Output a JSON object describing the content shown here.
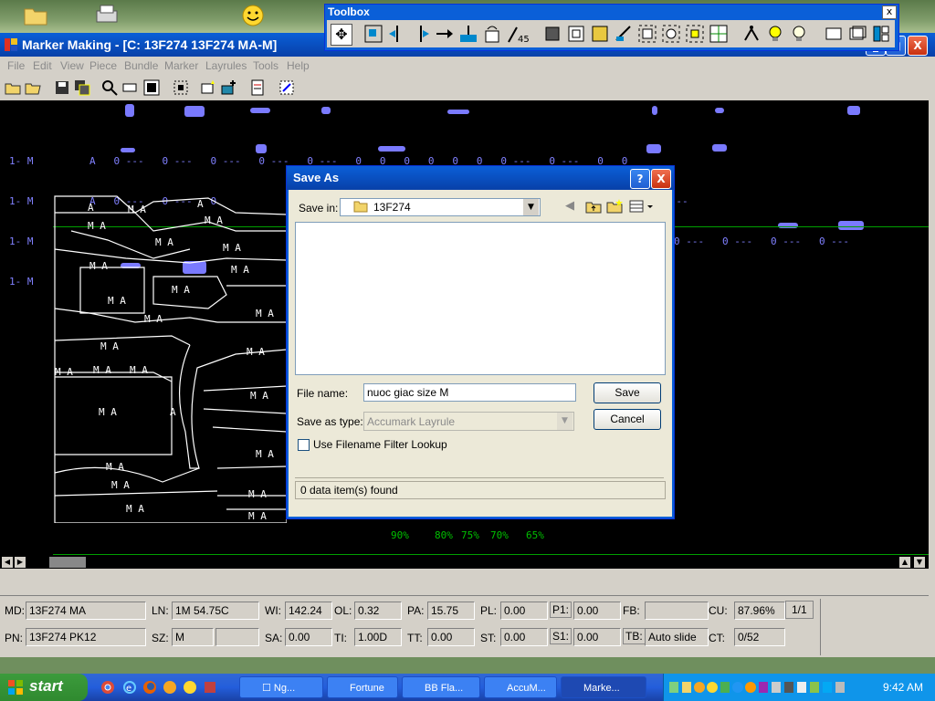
{
  "window": {
    "title": "Marker Making - [C:  13F274  13F274 MA-M]",
    "minimize_label": "_",
    "maximize_label": "□",
    "close_label": "X"
  },
  "toolbox": {
    "title": "Toolbox",
    "close_label": "x"
  },
  "menu": [
    "File",
    "Edit",
    "View",
    "Piece",
    "Bundle",
    "Marker",
    "Layrules",
    "Tools",
    "Help"
  ],
  "canvas": {
    "rows": [
      {
        "label": "1- M",
        "text": "A   0 ---   0 ---   0 ---   0 ---   0 ---   0   0   0   0   0   0   0 ---   0 ---   0   0"
      },
      {
        "label": "1- M",
        "text": "A   0 ---   0 ---   0                                                         0 ---   0 ---   0 ---"
      },
      {
        "label": "1- M",
        "text": ""
      },
      {
        "label": "1- M",
        "text": ""
      }
    ],
    "right_rows": [
      {
        "text": "0   0 ---   0 ---   0 ---"
      },
      {
        "text": "0 ---   0 ---   0 ---   0 ---"
      }
    ],
    "piece_label": "M A",
    "percent_marks": [
      "90%",
      "80%",
      "75%",
      "70%",
      "65%"
    ]
  },
  "status": {
    "md_label": "MD:",
    "md_value": "13F274 MA",
    "ln_label": "LN:",
    "ln_value": "1M 54.75C",
    "wi_label": "WI:",
    "wi_value": "142.24",
    "ol_label": "OL:",
    "ol_value": "0.32",
    "pa_label": "PA:",
    "pa_value": "15.75",
    "pl_label": "PL:",
    "pl_value": "0.00",
    "p1_label": "P1:",
    "p1_value": "0.00",
    "fb_label": "FB:",
    "fb_value": "",
    "cu_label": "CU:",
    "cu_value": "87.96%",
    "page_value": "1/1",
    "pn_label": "PN:",
    "pn_value": "13F274 PK12",
    "sz_label": "SZ:",
    "sz_value": "M",
    "sz_extra": "",
    "sa_label": "SA:",
    "sa_value": "0.00",
    "ti_label": "TI:",
    "ti_value": "1.00D",
    "tt_label": "TT:",
    "tt_value": "0.00",
    "st_label": "ST:",
    "st_value": "0.00",
    "s1_label": "S1:",
    "s1_value": "0.00",
    "tb_label": "TB:",
    "tb_value": "Auto slide",
    "ct_label": "CT:",
    "ct_value": "0/52"
  },
  "dialog": {
    "title": "Save As",
    "help_label": "?",
    "close_label": "X",
    "save_in_label": "Save in:",
    "save_in_value": "13F274",
    "file_name_label": "File name:",
    "file_name_value": "nuoc giac size M",
    "save_as_type_label": "Save as type:",
    "save_as_type_value": "Accumark Layrule",
    "filter_checkbox_label": "Use Filename Filter Lookup",
    "filter_checked": false,
    "status_text": "0 data item(s) found",
    "save_button": "Save",
    "cancel_button": "Cancel"
  },
  "taskbar": {
    "start_label": "start",
    "tasks": [
      {
        "label": "☐ Ng...",
        "active": false
      },
      {
        "label": "Fortune",
        "active": false
      },
      {
        "label": "BB Fla...",
        "active": false
      },
      {
        "label": "AccuM...",
        "active": false
      },
      {
        "label": "Marke...",
        "active": true
      }
    ],
    "clock": "9:42 AM"
  },
  "colors": {
    "title_blue": "#0a5fd8",
    "canvas_bg": "#000000",
    "plot_text": "#8080ff",
    "percent_green": "#00c000",
    "close_red": "#e04020",
    "start_green": "#2f8a2f"
  }
}
